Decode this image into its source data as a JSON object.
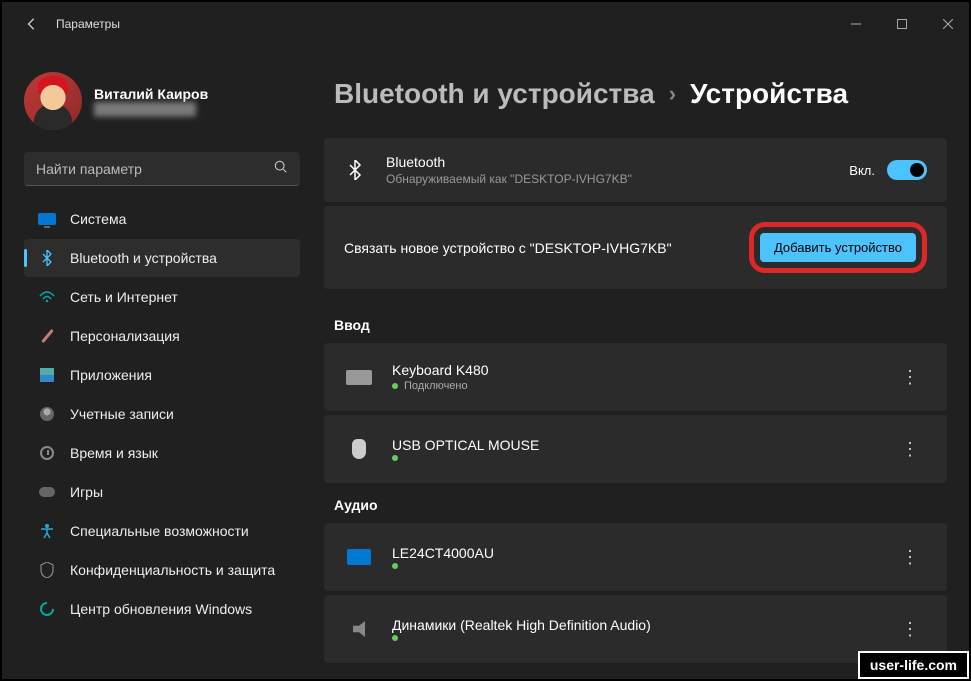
{
  "window": {
    "title": "Параметры"
  },
  "profile": {
    "name": "Виталий Каиров",
    "email": "████████████"
  },
  "search": {
    "placeholder": "Найти параметр"
  },
  "sidebar": {
    "items": [
      {
        "label": "Система"
      },
      {
        "label": "Bluetooth и устройства"
      },
      {
        "label": "Сеть и Интернет"
      },
      {
        "label": "Персонализация"
      },
      {
        "label": "Приложения"
      },
      {
        "label": "Учетные записи"
      },
      {
        "label": "Время и язык"
      },
      {
        "label": "Игры"
      },
      {
        "label": "Специальные возможности"
      },
      {
        "label": "Конфиденциальность и защита"
      },
      {
        "label": "Центр обновления Windows"
      }
    ]
  },
  "breadcrumb": {
    "parent": "Bluetooth и устройства",
    "current": "Устройства"
  },
  "bluetooth": {
    "title": "Bluetooth",
    "subtitle": "Обнаруживаемый как \"DESKTOP-IVHG7KB\"",
    "state_label": "Вкл."
  },
  "pair": {
    "text": "Связать новое устройство с \"DESKTOP-IVHG7KB\"",
    "button": "Добавить устройство"
  },
  "sections": {
    "input": {
      "title": "Ввод",
      "devices": [
        {
          "name": "Keyboard K480",
          "status": "Подключено"
        },
        {
          "name": "USB OPTICAL MOUSE",
          "status": ""
        }
      ]
    },
    "audio": {
      "title": "Аудио",
      "devices": [
        {
          "name": "LE24CT4000AU",
          "status": ""
        },
        {
          "name": "Динамики (Realtek High Definition Audio)",
          "status": ""
        }
      ]
    }
  },
  "watermark": "user-life.com"
}
